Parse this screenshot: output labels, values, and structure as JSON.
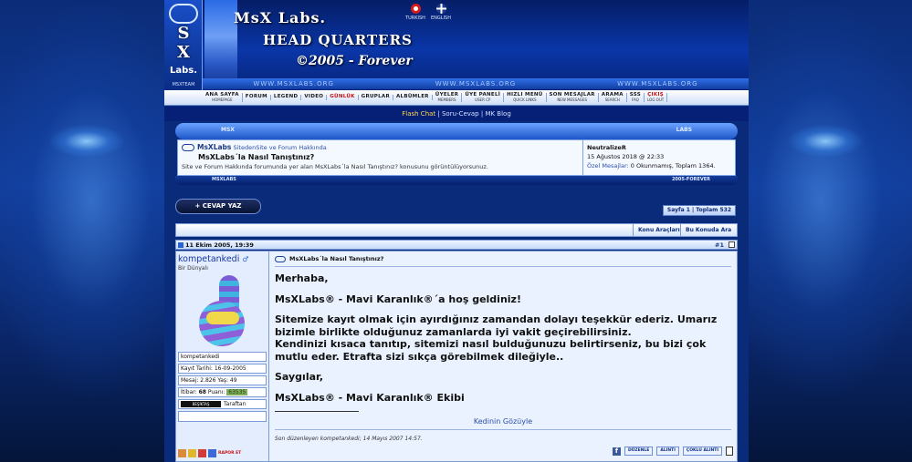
{
  "header": {
    "logo_letters": [
      "S",
      "X"
    ],
    "logo_labs": "Labs.",
    "logo_team": "MSXTEAM",
    "title_line1": "MsX Labs.",
    "title_line2": "HEAD QUARTERS",
    "title_line3": "©2005 - Forever",
    "lang_tr": "TURKISH",
    "lang_en": "ENGLISH",
    "url_repeat": "WWW.MSXLABS.ORG"
  },
  "nav": [
    {
      "main": "ANA SAYFA",
      "sub": "HOMEPAGE"
    },
    {
      "main": "FORUM",
      "sub": ""
    },
    {
      "main": "LEGEND",
      "sub": ""
    },
    {
      "main": "VIDEO",
      "sub": ""
    },
    {
      "main": "GÜNLÜK",
      "sub": ""
    },
    {
      "main": "GRUPLAR",
      "sub": ""
    },
    {
      "main": "ALBÜMLER",
      "sub": ""
    },
    {
      "main": "ÜYELER",
      "sub": "MEMBERS"
    },
    {
      "main": "ÜYE PANELİ",
      "sub": "USER CP"
    },
    {
      "main": "HIZLI MENÜ",
      "sub": "QUICK LINKS"
    },
    {
      "main": "SON MESAJLAR",
      "sub": "NEW MESSAGES"
    },
    {
      "main": "ARAMA",
      "sub": "SEARCH"
    },
    {
      "main": "SSS",
      "sub": "FAQ"
    },
    {
      "main": "ÇIKIŞ",
      "sub": "LOG OUT"
    }
  ],
  "flashlinks": {
    "flash_chat": "Flash Chat",
    "sep1": " | ",
    "soru_cevap": "Soru-Cevap",
    "sep2": " | ",
    "mk_blog": "MK Blog"
  },
  "info": {
    "tag_left": "MSX",
    "tag_right": "LABS",
    "crumb_site": "MsXLabs",
    "crumb_forum": "SitedenSite ve Forum Hakkında",
    "thread_title": "MsXLabs´la Nasıl Tanıştınız?",
    "thread_desc": "Site ve Forum Hakkında forumunda yer alan MsXLabs´la Nasıl Tanıştınız? konusunu görüntülüyorsunuz.",
    "user": "NeutralizeR",
    "datetime": "15 Ağustos 2018 @ 22:33",
    "pm_label": "Özel Mesajlar:",
    "pm_value": " 0 Okunmamış, Toplam 1364.",
    "bottom_left": "MSXLABS",
    "bottom_right": "2005-FOREVER"
  },
  "thread": {
    "reply_label": "+ CEVAP YAZ",
    "pager": "Sayfa 1 | Toplam 532",
    "tool_1": "Konu Araçları",
    "tool_2": "Bu Konuda Ara"
  },
  "post": {
    "date": "11 Ekim 2005, 19:39",
    "number": "#1",
    "username": "kompetankedi",
    "gender_icon": "♂",
    "rank": "Bir Dünyalı",
    "stat_name": "kompetankedi",
    "stat_joined": "Kayıt Tarihi: 16-09-2005",
    "stat_msgs": "Mesaj: 2.826  Yaş: 49",
    "stat_credit_label": "İtibar: ",
    "stat_credit_value": "68",
    "stat_points_label": " Puanı: ",
    "stat_points_value": "63535",
    "team_badge": "BEŞİKTAŞ",
    "team_label": "Taraftarı",
    "rep_label": "RAPOR ET",
    "title": "MsXLabs´la Nasıl Tanıştınız?",
    "line_1": "Merhaba,",
    "line_2": "MsXLabs® - Mavi Karanlık®´a hoş geldiniz!",
    "line_3": "Sitemize kayıt olmak için ayırdığınız zamandan dolayı teşekkür ederiz. Umarız bizimle birlikte olduğunuz zamanlarda iyi vakit geçirebilirsiniz.",
    "line_4": "Kendinizi kısaca tanıtıp, sitemizi nasıl bulduğunuzu belirtirseniz, bu bizi çok mutlu eder. Etrafta sizi sıkça görebilmek dileğiyle..",
    "line_5": "Saygılar,",
    "line_6": "MsXLabs® - Mavi Karanlık® Ekibi",
    "sig_link": "Kedinin Gözüyle",
    "edited": "Son düzenleyen kompetankedi; 14 Mayıs 2007 14:57.",
    "btn_fb": "f",
    "btn_edit": "DÜZENLE",
    "btn_quote": "ALINTI",
    "btn_multi": "ÇOKLU ALINTI"
  }
}
